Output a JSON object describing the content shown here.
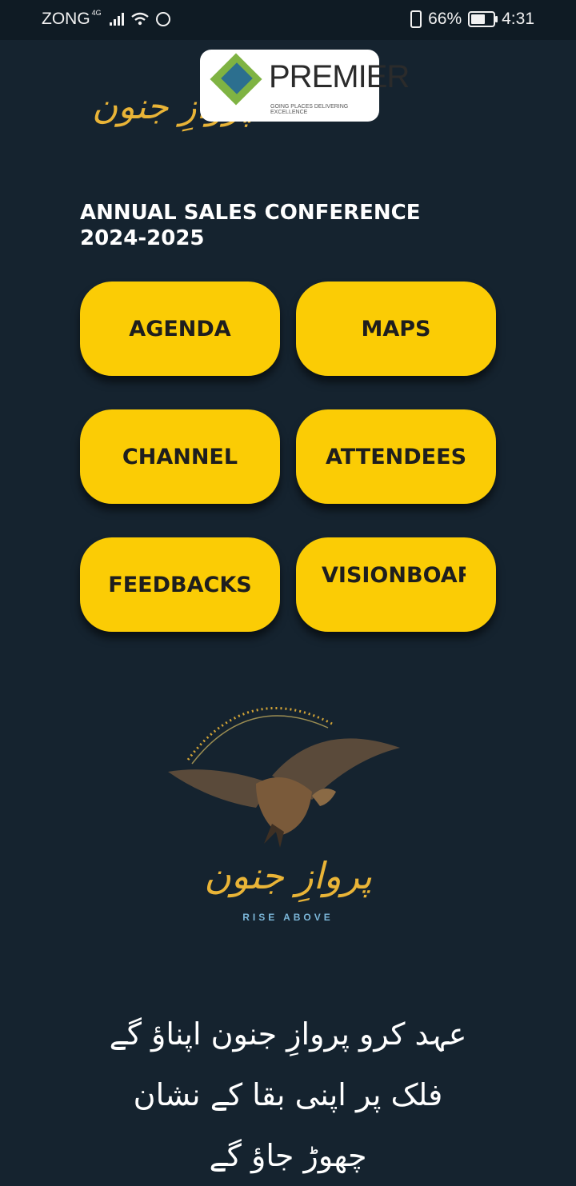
{
  "status_bar": {
    "carrier": "ZONG",
    "network": "4G",
    "battery_percent": "66%",
    "time": "4:31"
  },
  "header": {
    "brand_urdu": "پروازِ جنون",
    "partner_logo_text": "PREMIER",
    "partner_tagline": "GOING PLACES DELIVERING EXCELLENCE"
  },
  "conference": {
    "title_line1": "ANNUAL SALES CONFERENCE",
    "title_line2": "2024-2025"
  },
  "menu": {
    "agenda": "AGENDA",
    "maps": "MAPS",
    "channel": "CHANNEL",
    "attendees": "ATTENDEES",
    "feedbacks": "FEEDBACKS",
    "visionboard": "VISIONBOARD"
  },
  "emblem": {
    "brand_urdu": "پروازِ جنون",
    "slogan": "RISE ABOVE"
  },
  "poem": {
    "line1": "عہد کرو پروازِ جنون اپناؤ گے",
    "line2": "فلک پر اپنی بقا کے نشان",
    "line3": "چھوڑ جاؤ گے"
  },
  "colors": {
    "background": "#15232f",
    "button": "#fbcc05",
    "accent_gold": "#e9b437"
  }
}
